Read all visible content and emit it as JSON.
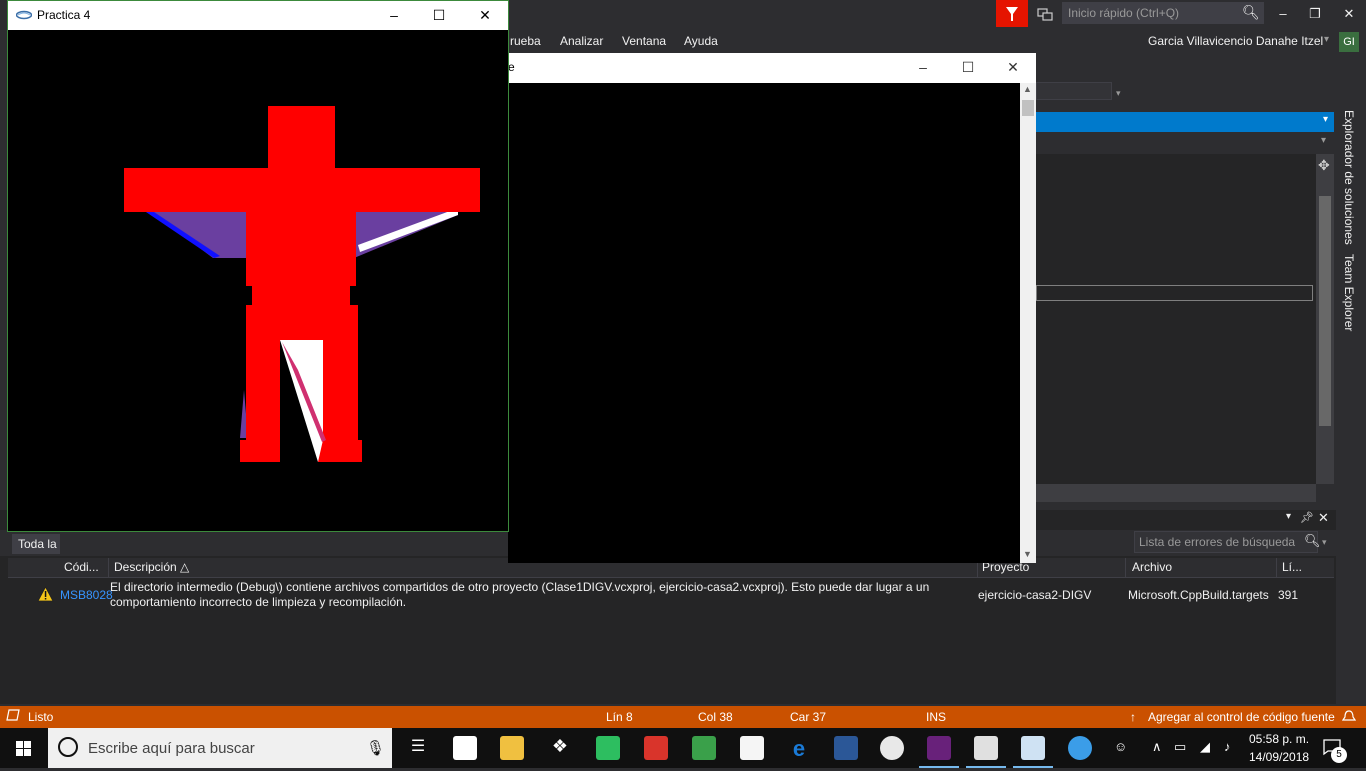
{
  "vs": {
    "quick_launch_placeholder": "Inicio rápido (Ctrl+Q)",
    "menu": [
      "rueba",
      "Analizar",
      "Ventana",
      "Ayuda"
    ],
    "user_name": "Garcia Villavicencio Danahe Itzel",
    "user_initials": "GI",
    "side_tabs": [
      "Explorador de soluciones",
      "Team Explorer"
    ]
  },
  "error_list": {
    "filter_label": "Toda la",
    "search_placeholder": "Lista de errores de búsqueda",
    "columns": [
      "Códi...",
      "Descripción",
      "Proyecto",
      "Archivo",
      "Lí..."
    ],
    "rows": [
      {
        "code": "MSB8028",
        "description": "El directorio intermedio (Debug\\) contiene archivos compartidos de otro proyecto (Clase1DIGV.vcxproj, ejercicio-casa2.vcxproj). Esto puede dar lugar a un comportamiento incorrecto de limpieza y recompilación.",
        "project": "ejercicio-casa2-DIGV",
        "file": "Microsoft.CppBuild.targets",
        "line": "391"
      }
    ]
  },
  "statusbar": {
    "state": "Listo",
    "line": "Lín 8",
    "col": "Col 38",
    "car": "Car 37",
    "mode": "INS",
    "source_control": "Agregar al control de código fuente"
  },
  "console_window": {
    "title_fragment": "e"
  },
  "gl_window": {
    "title": "Practica 4"
  },
  "taskbar": {
    "search_placeholder": "Escribe aquí para buscar",
    "time": "05:58 p. m.",
    "date": "14/09/2018",
    "notification_count": "5"
  },
  "colors": {
    "accent": "#007acc",
    "statusbar": "#ca5100",
    "figure_red": "#ff0000",
    "figure_purple": "#6a3fa0"
  }
}
